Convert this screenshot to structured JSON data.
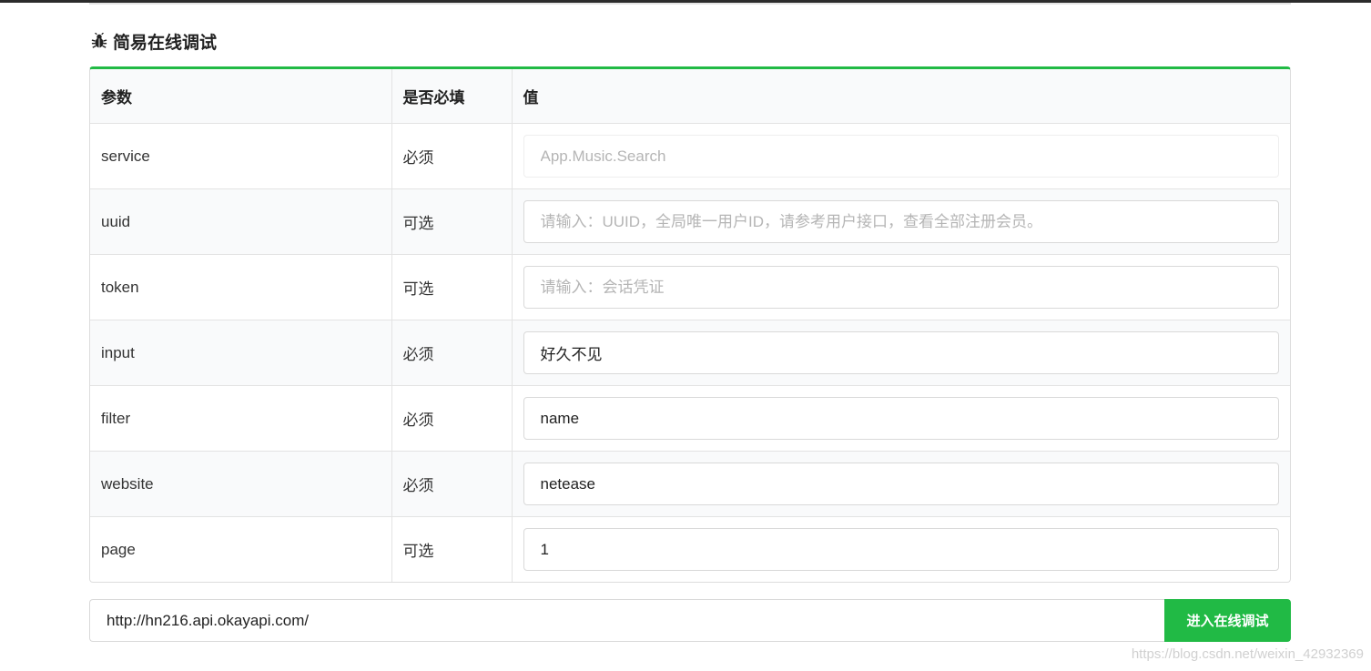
{
  "section": {
    "title": "简易在线调试"
  },
  "table": {
    "headers": {
      "param": "参数",
      "required": "是否必填",
      "value": "值"
    },
    "rows": [
      {
        "param": "service",
        "required": "必须",
        "value": "",
        "placeholder": "App.Music.Search"
      },
      {
        "param": "uuid",
        "required": "可选",
        "value": "",
        "placeholder": "请输入：UUID，全局唯一用户ID，请参考用户接口，查看全部注册会员。"
      },
      {
        "param": "token",
        "required": "可选",
        "value": "",
        "placeholder": "请输入：会话凭证"
      },
      {
        "param": "input",
        "required": "必须",
        "value": "好久不见",
        "placeholder": ""
      },
      {
        "param": "filter",
        "required": "必须",
        "value": "name",
        "placeholder": ""
      },
      {
        "param": "website",
        "required": "必须",
        "value": "netease",
        "placeholder": ""
      },
      {
        "param": "page",
        "required": "可选",
        "value": "1",
        "placeholder": ""
      }
    ]
  },
  "request": {
    "url": "http://hn216.api.okayapi.com/",
    "submit_label": "进入在线调试"
  },
  "watermark": "https://blog.csdn.net/weixin_42932369",
  "colors": {
    "accent_green": "#21ba45",
    "required_red": "#db2828"
  }
}
